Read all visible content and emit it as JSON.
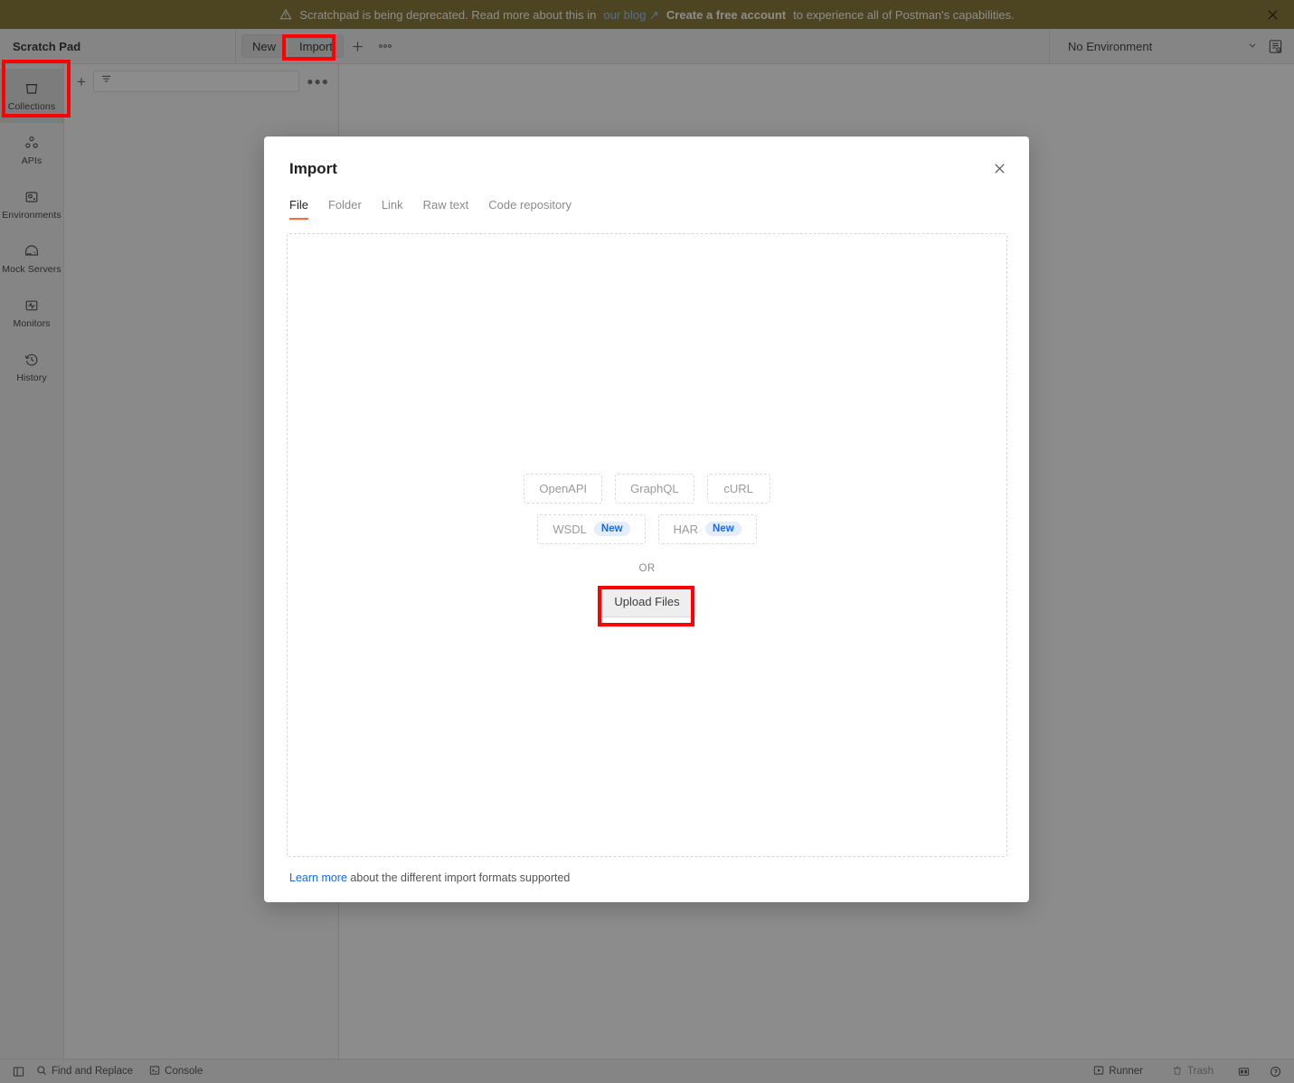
{
  "banner": {
    "icon": "warning-triangle-icon",
    "text_before": "Scratchpad is being deprecated. Read more about this in",
    "link": "our blog ↗",
    "strong": "Create a free account",
    "text_after": "to experience all of Postman's capabilities.",
    "close_icon": "close-icon",
    "background": "#8d7c3f",
    "link_color": "#9ecbff"
  },
  "topbar": {
    "title": "Scratch Pad",
    "new_label": "New",
    "import_label": "Import",
    "plus_icon": "plus-icon",
    "more_icon": "ellipsis-icon",
    "environment": "No Environment",
    "chevron_icon": "chevron-down-icon",
    "eye_icon": "environment-quick-look-icon"
  },
  "rail": {
    "items": [
      {
        "label": "Collections",
        "icon": "collections-icon",
        "active": true
      },
      {
        "label": "APIs",
        "icon": "apis-icon",
        "active": false
      },
      {
        "label": "Environments",
        "icon": "environments-icon",
        "active": false
      },
      {
        "label": "Mock Servers",
        "icon": "mock-servers-icon",
        "active": false
      },
      {
        "label": "Monitors",
        "icon": "monitors-icon",
        "active": false
      },
      {
        "label": "History",
        "icon": "history-icon",
        "active": false
      }
    ]
  },
  "sidebar": {
    "add_icon": "plus-icon",
    "filter_icon": "filter-icon",
    "search_placeholder": "",
    "search_value": "",
    "more_icon": "ellipsis-icon"
  },
  "modal": {
    "title": "Import",
    "close_icon": "close-icon",
    "tabs": [
      {
        "label": "File",
        "active": true
      },
      {
        "label": "Folder",
        "active": false
      },
      {
        "label": "Link",
        "active": false
      },
      {
        "label": "Raw text",
        "active": false
      },
      {
        "label": "Code repository",
        "active": false
      }
    ],
    "active_tab_color": "#ff6c37",
    "chips_row1": [
      {
        "label": "OpenAPI",
        "badge": ""
      },
      {
        "label": "GraphQL",
        "badge": ""
      },
      {
        "label": "cURL",
        "badge": ""
      }
    ],
    "chips_row2": [
      {
        "label": "WSDL",
        "badge": "New"
      },
      {
        "label": "HAR",
        "badge": "New"
      }
    ],
    "or_label": "OR",
    "upload_label": "Upload Files",
    "footer_link": "Learn more",
    "footer_text": "about the different import formats supported",
    "badge_color": "#1a6ce7",
    "badge_background": "#e3edfd",
    "link_color": "#1a6ce7"
  },
  "statusbar": {
    "sidebar_toggle_icon": "sidebar-toggle-icon",
    "find_replace_label": "Find and Replace",
    "find_replace_icon": "search-icon",
    "console_label": "Console",
    "console_icon": "console-icon",
    "runner_label": "Runner",
    "runner_icon": "play-icon",
    "trash_label": "Trash",
    "trash_icon": "trash-icon",
    "layout_icon": "two-pane-layout-icon",
    "help_icon": "help-circle-icon"
  },
  "highlights": {
    "color": "#ff0000",
    "targets": [
      "collections-rail-item",
      "import-button",
      "upload-files-button"
    ]
  }
}
